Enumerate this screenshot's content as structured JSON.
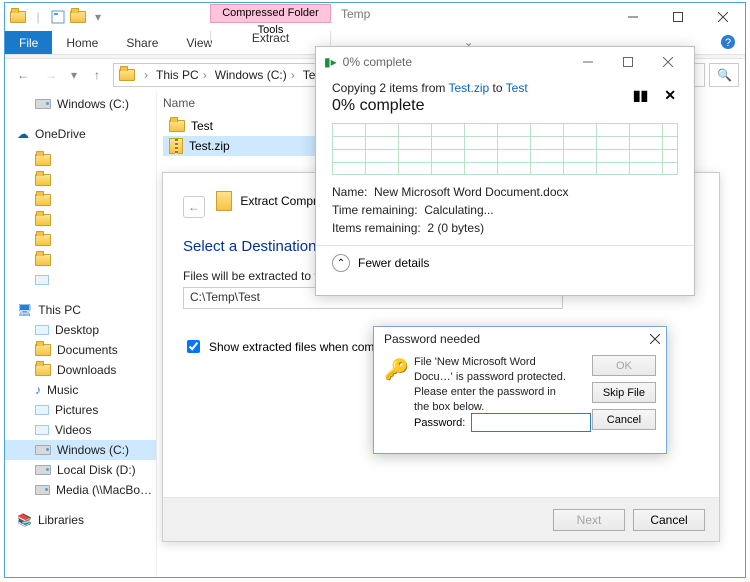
{
  "explorer": {
    "tool_tab": "Compressed Folder Tools",
    "title": "Temp",
    "ribbon": {
      "file": "File",
      "home": "Home",
      "share": "Share",
      "view": "View",
      "extract": "Extract"
    },
    "breadcrumbs": [
      "This PC",
      "Windows (C:)",
      "Temp"
    ],
    "col_name": "Name",
    "files": [
      {
        "name": "Test",
        "type": "folder"
      },
      {
        "name": "Test.zip",
        "type": "zip",
        "selected": true
      }
    ],
    "nav": {
      "windows_c": "Windows (C:)",
      "onedrive": "OneDrive",
      "this_pc": "This PC",
      "desktop": "Desktop",
      "documents": "Documents",
      "downloads": "Downloads",
      "music": "Music",
      "pictures": "Pictures",
      "videos": "Videos",
      "local_d": "Local Disk (D:)",
      "media": "Media (\\\\MacBo…",
      "libraries": "Libraries"
    }
  },
  "wizard": {
    "crumb": "Extract Compressed (",
    "heading": "Select a Destination",
    "label": "Files will be extracted to t",
    "path": "C:\\Temp\\Test",
    "checkbox": "Show extracted files when complete",
    "next": "Next",
    "cancel": "Cancel"
  },
  "copy": {
    "title": "0% complete",
    "line_pre": "Copying 2 items from ",
    "link1": "Test.zip",
    "mid": " to ",
    "link2": "Test",
    "percent": "0% complete",
    "name_lbl": "Name:",
    "name_val": "New Microsoft Word Document.docx",
    "time_lbl": "Time remaining:",
    "time_val": "Calculating...",
    "items_lbl": "Items remaining:",
    "items_val": "2 (0 bytes)",
    "fewer": "Fewer details"
  },
  "pw": {
    "title": "Password needed",
    "msg": "File 'New Microsoft Word Docu…' is password protected.  Please enter the password in the box below.",
    "label": "Password:",
    "ok": "OK",
    "skip": "Skip File",
    "cancel": "Cancel"
  }
}
